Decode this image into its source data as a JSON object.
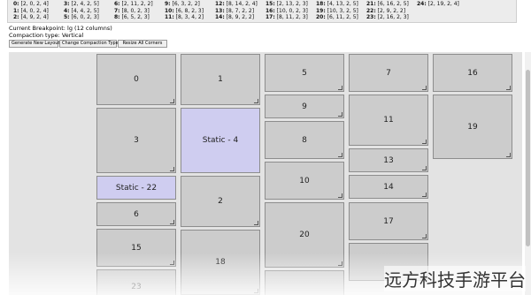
{
  "layout_table": [
    {
      "key": "0:",
      "val": " [2, 0, 2, 4]"
    },
    {
      "key": "1:",
      "val": " [4, 0, 2, 4]"
    },
    {
      "key": "2:",
      "val": " [4, 9, 2, 4]"
    },
    {
      "key": "3:",
      "val": " [2, 4, 2, 5]"
    },
    {
      "key": "4:",
      "val": " [4, 4, 2, 5]"
    },
    {
      "key": "5:",
      "val": " [6, 0, 2, 3]"
    },
    {
      "key": "6:",
      "val": " [2, 11, 2, 2]"
    },
    {
      "key": "7:",
      "val": " [8, 0, 2, 3]"
    },
    {
      "key": "8:",
      "val": " [6, 5, 2, 3]"
    },
    {
      "key": "9:",
      "val": " [6, 3, 2, 2]"
    },
    {
      "key": "10:",
      "val": " [6, 8, 2, 3]"
    },
    {
      "key": "11:",
      "val": " [8, 3, 4, 2]"
    },
    {
      "key": "12:",
      "val": " [8, 14, 2, 4]"
    },
    {
      "key": "13:",
      "val": " [8, 7, 2, 2]"
    },
    {
      "key": "14:",
      "val": " [8, 9, 2, 2]"
    },
    {
      "key": "15:",
      "val": " [2, 13, 2, 3]"
    },
    {
      "key": "16:",
      "val": " [10, 0, 2, 3]"
    },
    {
      "key": "17:",
      "val": " [8, 11, 2, 3]"
    },
    {
      "key": "18:",
      "val": " [4, 13, 2, 5]"
    },
    {
      "key": "19:",
      "val": " [10, 3, 2, 5]"
    },
    {
      "key": "20:",
      "val": " [6, 11, 2, 5]"
    },
    {
      "key": "21:",
      "val": " [6, 16, 2, 5]"
    },
    {
      "key": "22:",
      "val": " [2, 9, 2, 2]"
    },
    {
      "key": "23:",
      "val": " [2, 16, 2, 3]"
    },
    {
      "key": "24:",
      "val": " [2, 19, 2, 4]"
    }
  ],
  "info": {
    "breakpoint": "Current Breakpoint: lg (12 columns)",
    "compaction": "Compaction type: Vertical"
  },
  "controls": {
    "generate": "Generate New Layout",
    "compaction": "Change Compaction Type",
    "resize": "Resize All Corners"
  },
  "grid_items": [
    {
      "label": "0"
    },
    {
      "label": "1"
    },
    {
      "label": "5"
    },
    {
      "label": "7"
    },
    {
      "label": "16"
    },
    {
      "label": "9"
    },
    {
      "label": "11"
    },
    {
      "label": "19"
    },
    {
      "label": "3"
    },
    {
      "label": "Static - 4",
      "static": true
    },
    {
      "label": "8"
    },
    {
      "label": "13"
    },
    {
      "label": "Static - 22",
      "static": true
    },
    {
      "label": "10"
    },
    {
      "label": "14"
    },
    {
      "label": "2"
    },
    {
      "label": "6"
    },
    {
      "label": "17"
    },
    {
      "label": "20"
    },
    {
      "label": "15"
    },
    {
      "label": "18"
    },
    {
      "label": ""
    },
    {
      "label": "23"
    },
    {
      "label": ""
    },
    {
      "label": ""
    }
  ],
  "watermark": "远方科技手游平台"
}
